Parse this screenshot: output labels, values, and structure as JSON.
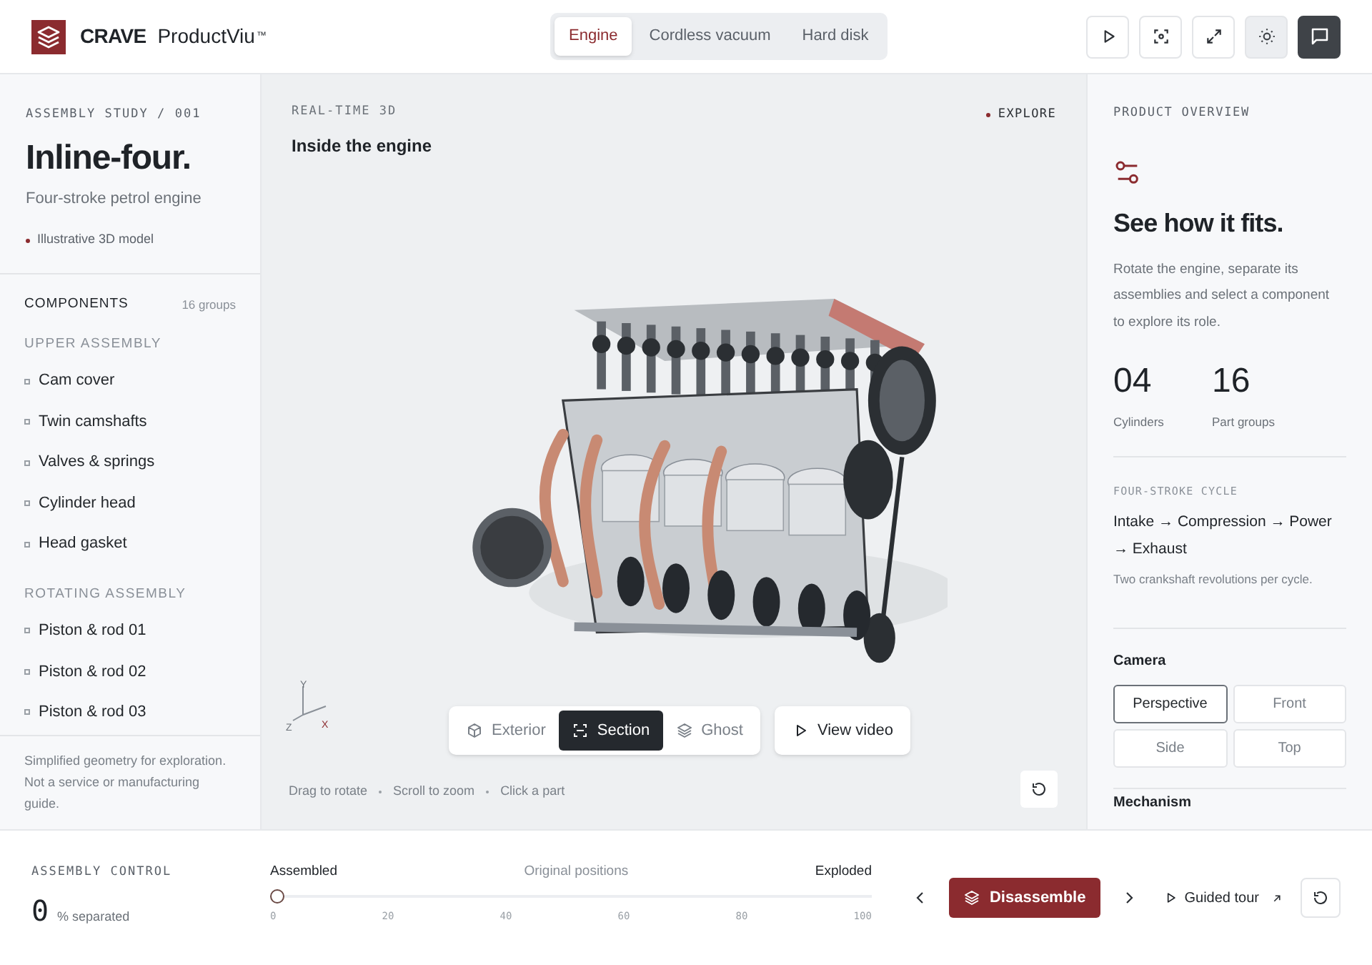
{
  "header": {
    "brand": "CRAVE",
    "product": "ProductViu",
    "trademark": "™"
  },
  "product_tabs": [
    {
      "label": "Engine",
      "selected": true
    },
    {
      "label": "Cordless vacuum",
      "selected": false
    },
    {
      "label": "Hard disk",
      "selected": false
    }
  ],
  "toolbar": [
    {
      "kind": "play",
      "active": false
    },
    {
      "kind": "focus",
      "active": false
    },
    {
      "kind": "expand",
      "active": false
    },
    {
      "kind": "sun",
      "active": true
    },
    {
      "kind": "chat",
      "dark": true
    }
  ],
  "left": {
    "eyebrow": "ASSEMBLY STUDY / 001",
    "title": "Inline-four.",
    "subtitle": "Four-stroke petrol engine",
    "note": "Illustrative 3D model",
    "components_label": "COMPONENTS",
    "components_count": "16 groups",
    "groups": [
      {
        "label": "UPPER ASSEMBLY",
        "items": [
          "Cam cover",
          "Twin camshafts",
          "Valves & springs",
          "Cylinder head",
          "Head gasket"
        ]
      },
      {
        "label": "ROTATING ASSEMBLY",
        "items": [
          "Piston & rod 01",
          "Piston & rod 02",
          "Piston & rod 03"
        ]
      }
    ],
    "footer": "Simplified geometry for exploration. Not a service or manufacturing guide."
  },
  "viewport": {
    "eyebrow": "REAL-TIME 3D",
    "title": "Inside the engine",
    "mode_label": "EXPLORE",
    "axes": [
      "Y",
      "Z",
      "X"
    ],
    "view_modes": [
      {
        "kind": "cube",
        "label": "Exterior",
        "selected": false
      },
      {
        "kind": "section",
        "label": "Section",
        "selected": true
      },
      {
        "kind": "layers",
        "label": "Ghost",
        "selected": false
      }
    ],
    "video_button": "View video",
    "hints": [
      "Drag to rotate",
      "Scroll to zoom",
      "Click a part"
    ]
  },
  "right": {
    "eyebrow": "PRODUCT OVERVIEW",
    "title": "See how it fits.",
    "body": "Rotate the engine, separate its assemblies and select a component to explore its role.",
    "stats": [
      {
        "value": "04",
        "label": "Cylinders"
      },
      {
        "value": "16",
        "label": "Part groups"
      }
    ],
    "cycle_label": "FOUR-STROKE CYCLE",
    "cycle": "Intake → Compression → Power → Exhaust",
    "cycle_note": "Two crankshaft revolutions per cycle.",
    "camera_label": "Camera",
    "camera_options": [
      {
        "label": "Perspective",
        "selected": true
      },
      {
        "label": "Front",
        "selected": false
      },
      {
        "label": "Side",
        "selected": false
      },
      {
        "label": "Top",
        "selected": false
      }
    ],
    "next_section": "Mechanism"
  },
  "bottom": {
    "label": "ASSEMBLY CONTROL",
    "value": "0",
    "unit": "% separated",
    "slider_left": "Assembled",
    "slider_mid": "Original positions",
    "slider_right": "Exploded",
    "level": 0,
    "ticks": [
      "0",
      "20",
      "40",
      "60",
      "80",
      "100"
    ],
    "primary_button": "Disassemble",
    "tour_link": "Guided tour"
  }
}
